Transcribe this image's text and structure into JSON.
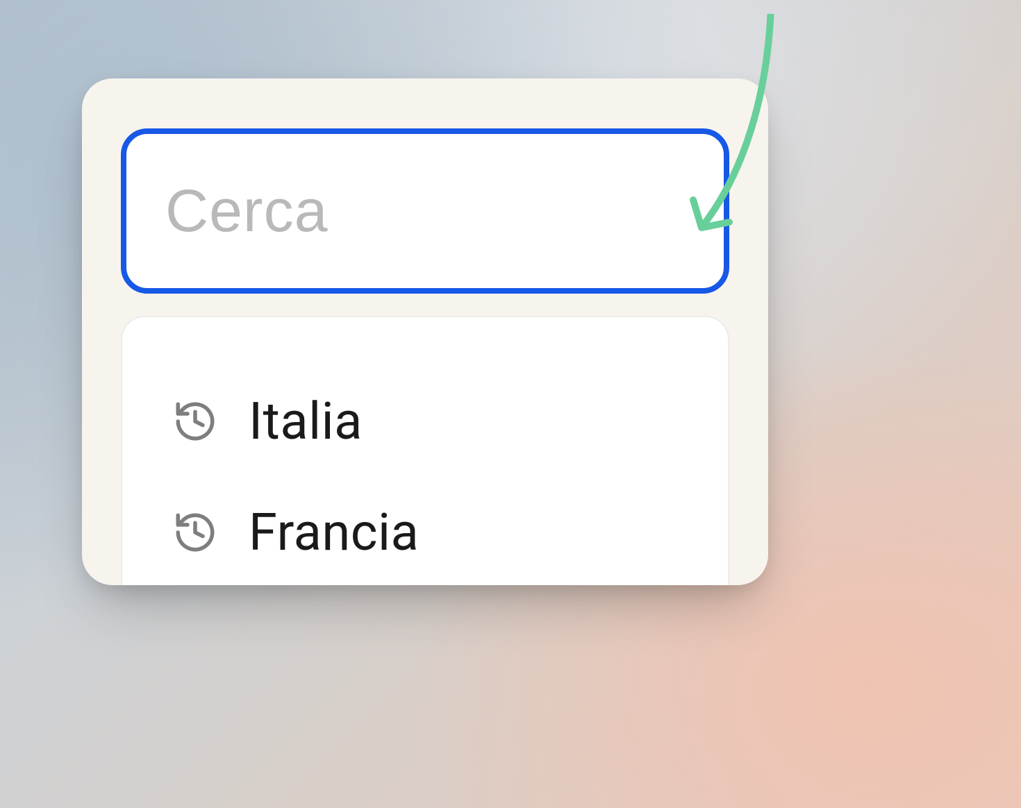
{
  "search": {
    "placeholder": "Cerca",
    "value": ""
  },
  "results": [
    {
      "label": "Italia",
      "icon": "history-icon"
    },
    {
      "label": "Francia",
      "icon": "history-icon"
    }
  ],
  "colors": {
    "focus_border": "#1758e6",
    "arrow": "#68cf9a"
  }
}
